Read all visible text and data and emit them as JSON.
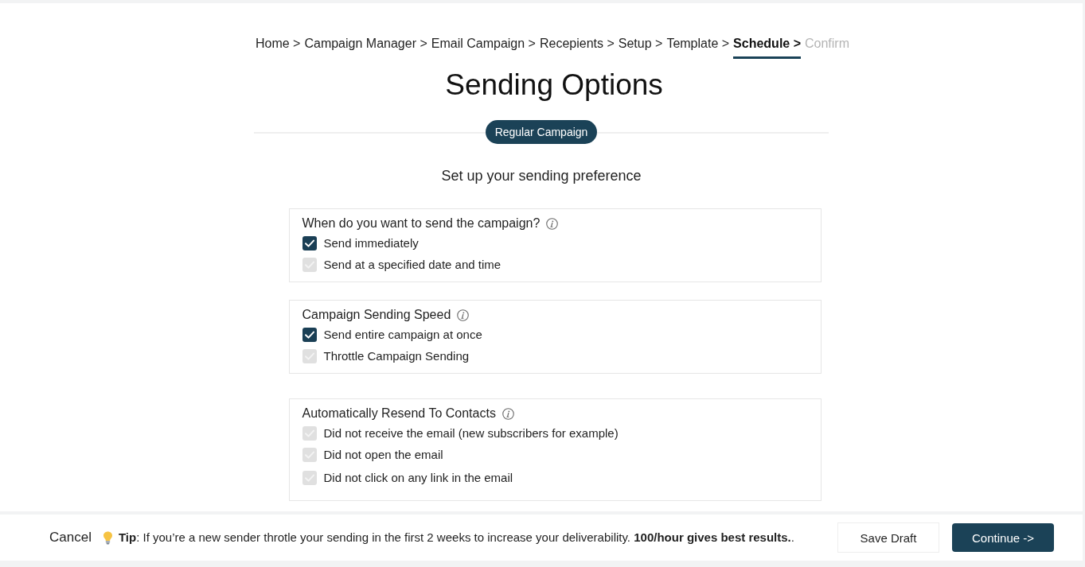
{
  "breadcrumb": [
    {
      "label": "Home >",
      "selected": false,
      "disabled": false
    },
    {
      "label": "Campaign Manager >",
      "selected": false,
      "disabled": false
    },
    {
      "label": "Email Campaign >",
      "selected": false,
      "disabled": false
    },
    {
      "label": "Recepients >",
      "selected": false,
      "disabled": false
    },
    {
      "label": "Setup >",
      "selected": false,
      "disabled": false
    },
    {
      "label": "Template >",
      "selected": false,
      "disabled": false
    },
    {
      "label": "Schedule >",
      "selected": true,
      "disabled": false
    },
    {
      "label": "Confirm",
      "selected": false,
      "disabled": true
    }
  ],
  "title": "Sending Options",
  "campaign_type": {
    "label": "Regular Campaign"
  },
  "subtitle": "Set up your sending preference",
  "sections": [
    {
      "title": "When do you want to send the campaign?",
      "options": [
        {
          "label": "Send immediately",
          "checked": true
        },
        {
          "label": "Send at a specified date and time",
          "checked": false
        }
      ]
    },
    {
      "title": "Campaign Sending Speed",
      "options": [
        {
          "label": "Send entire campaign at once",
          "checked": true
        },
        {
          "label": "Throttle Campaign Sending",
          "checked": false
        }
      ]
    },
    {
      "title": "Automatically Resend To Contacts",
      "options": [
        {
          "label": "Did not receive the email (new subscribers for example)",
          "checked": false
        },
        {
          "label": "Did not open the email",
          "checked": false
        },
        {
          "label": "Did not click on any link in the email",
          "checked": false
        }
      ]
    }
  ],
  "footer": {
    "cancel": "Cancel",
    "tip": "**Tip**: If you’re a new sender throtle your sending in the first 2 weeks to increase your deliverability. **100/hour gives best results.**.",
    "buttons": [
      {
        "label": "Save Draft",
        "kind": "secondary"
      },
      {
        "label": "Continue ->",
        "kind": "primary"
      }
    ]
  }
}
